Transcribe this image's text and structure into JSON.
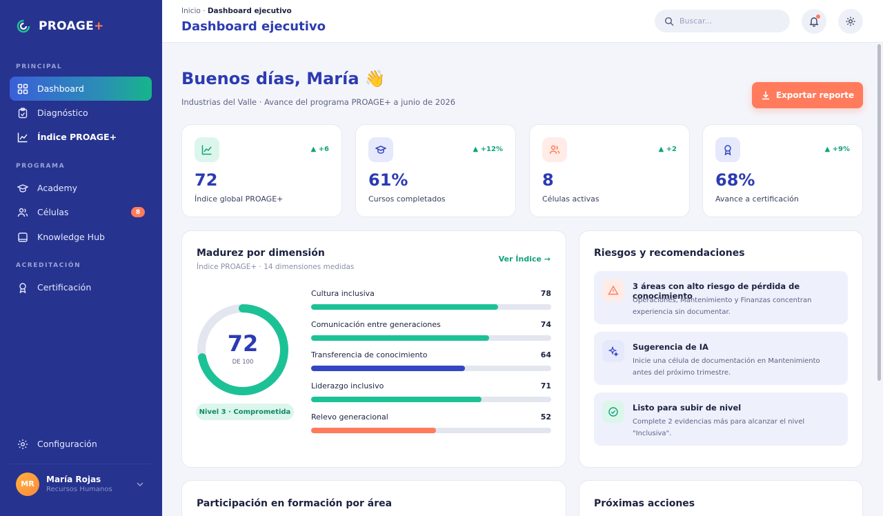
{
  "brand": {
    "name": "PROAGE",
    "plus": "+"
  },
  "sidebar": {
    "sections": {
      "principal": "PRINCIPAL",
      "programa": "PROGRAMA",
      "acreditacion": "ACREDITACIÓN"
    },
    "items": [
      {
        "label": "Dashboard",
        "icon": "grid-icon"
      },
      {
        "label": "Diagnóstico",
        "icon": "clipboard-icon"
      },
      {
        "label": "Índice PROAGE+",
        "icon": "chart-line-icon"
      },
      {
        "label": "Academy",
        "icon": "graduation-cap-icon"
      },
      {
        "label": "Células",
        "icon": "users-icon",
        "badge": "8"
      },
      {
        "label": "Knowledge Hub",
        "icon": "book-icon"
      },
      {
        "label": "Certificación",
        "icon": "award-icon"
      }
    ],
    "settings_label": "Configuración",
    "user": {
      "initials": "MR",
      "name": "María Rojas",
      "role": "Recursos Humanos"
    }
  },
  "topbar": {
    "breadcrumb_root": "Inicio",
    "breadcrumb_current": "Dashboard ejecutivo",
    "title": "Dashboard ejecutivo",
    "search_placeholder": "Buscar..."
  },
  "greeting": {
    "title": "Buenos días, María 👋",
    "subtitle": "Industrias del Valle · Avance del programa PROAGE+ a junio de 2026",
    "export_label": "Exportar reporte"
  },
  "kpis": [
    {
      "value": "72",
      "label": "Índice global PROAGE+",
      "delta": "▲ +6",
      "icon": "trend-icon",
      "color": "#11a27b",
      "bg": "#dcf6ec"
    },
    {
      "value": "61%",
      "label": "Cursos completados",
      "delta": "▲ +12%",
      "icon": "graduation-cap-icon",
      "color": "#3346c4",
      "bg": "#e6e9fb"
    },
    {
      "value": "8",
      "label": "Células activas",
      "delta": "▲ +2",
      "icon": "users-icon",
      "color": "#ff7b5c",
      "bg": "#ffece6"
    },
    {
      "value": "68%",
      "label": "Avance a certificación",
      "delta": "▲ +9%",
      "icon": "award-icon",
      "color": "#3346c4",
      "bg": "#e6e9fb"
    }
  ],
  "maturity": {
    "title": "Madurez por dimensión",
    "subtitle": "Índice PROAGE+ · 14 dimensiones medidas",
    "link": "Ver Índice →",
    "score": "72",
    "score_fraction": 0.72,
    "score_unit": "DE 100",
    "level": "Nivel 3 · Comprometida",
    "dimensions": [
      {
        "label": "Cultura inclusiva",
        "value": 78,
        "color": "#1cc296"
      },
      {
        "label": "Comunicación entre generaciones",
        "value": 74,
        "color": "#1cc296"
      },
      {
        "label": "Transferencia de conocimiento",
        "value": 64,
        "color": "#3346c4"
      },
      {
        "label": "Liderazgo inclusivo",
        "value": 71,
        "color": "#1cc296"
      },
      {
        "label": "Relevo generacional",
        "value": 52,
        "color": "#ff7b5c"
      }
    ]
  },
  "risks": {
    "title": "Riesgos y recomendaciones",
    "items": [
      {
        "title": "3 áreas con alto riesgo de pérdida de conocimiento",
        "text": "Operaciones, Mantenimiento y Finanzas concentran experiencia sin documentar.",
        "icon": "warning-icon"
      },
      {
        "title": "Sugerencia de IA",
        "text": "Inicie una célula de documentación en Mantenimiento antes del próximo trimestre.",
        "icon": "sparkle-icon"
      },
      {
        "title": "Listo para subir de nivel",
        "text": "Complete 2 evidencias más para alcanzar el nivel \"Inclusiva\".",
        "icon": "check-circle-icon"
      }
    ]
  },
  "bottom": {
    "participation_title": "Participación en formación por área",
    "next_title": "Próximas acciones"
  }
}
